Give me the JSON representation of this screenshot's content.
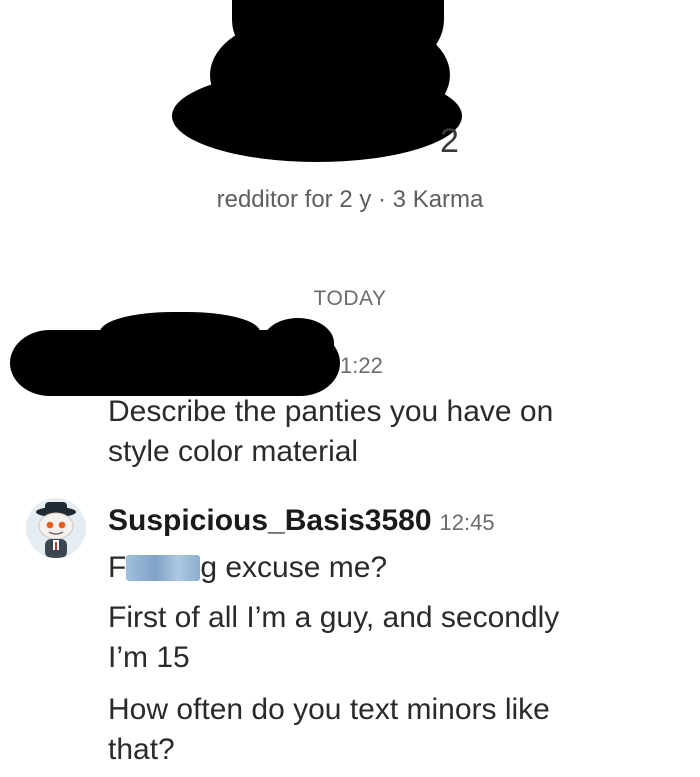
{
  "profile": {
    "username_visible_tail": "2",
    "meta": "redditor for 2 y · 3 Karma"
  },
  "chat": {
    "day_divider": "TODAY",
    "messages": [
      {
        "time": "1:22",
        "lines": [
          "Describe the panties you have on",
          "style color material"
        ]
      },
      {
        "author": "Suspicious_Basis3580",
        "time": "12:45",
        "line1_prefix": "F",
        "line1_suffix": "g excuse me?",
        "lines": [
          "First of all I’m a guy, and secondly",
          "I’m 15",
          "How often do you text minors like",
          "that?"
        ]
      }
    ]
  },
  "icons": {
    "avatar": "snoo-avatar-icon",
    "censor": "pixelated-censor-icon"
  },
  "colors": {
    "redaction": "#000000",
    "text": "#1c1c1c",
    "meta": "#5e5e5e",
    "censor": "#6a93bf"
  }
}
